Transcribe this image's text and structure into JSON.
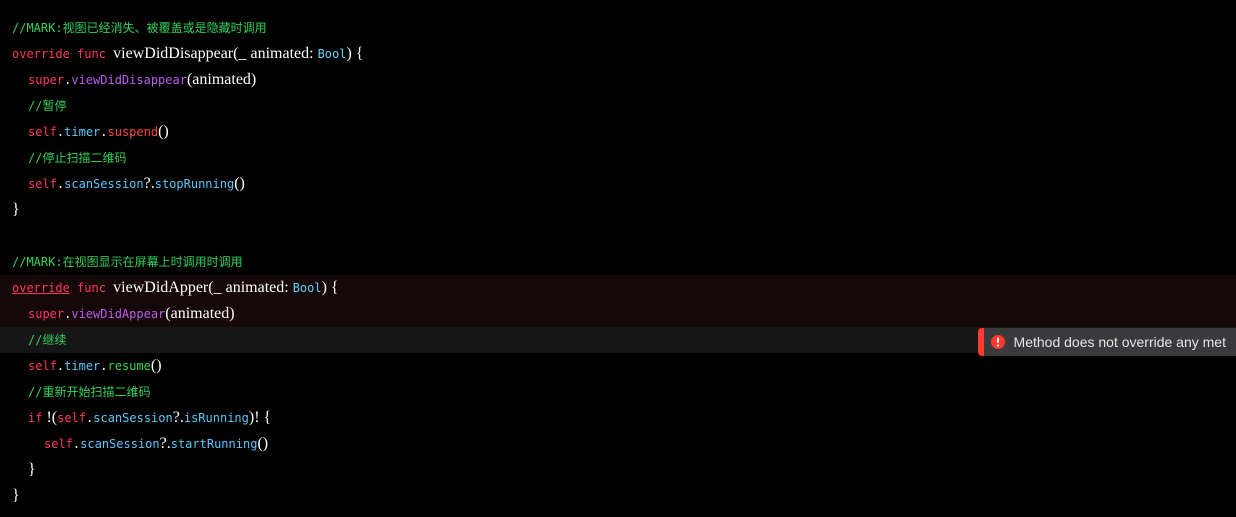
{
  "code": {
    "mark1": "//MARK:视图已经消失、被覆盖或是隐藏时调用",
    "override": "override",
    "func": "func",
    "fn1_name": "viewDidDisappear",
    "param_prefix": "(_ ",
    "animated": "animated",
    "colon_space": ": ",
    "bool": "Bool",
    "fn_tail": ") {",
    "super_call1_a": "super",
    "dot": ".",
    "super_call1_b": "viewDidDisappear",
    "args_open": "(",
    "args_animated": "animated",
    "args_close": ")",
    "comment_pause": "//暂停",
    "self": "self",
    "timer": "timer",
    "suspend": "suspend",
    "empty_parens": "()",
    "comment_stopscan": "//停止扫描二维码",
    "scanSession": "scanSession",
    "qmark_dot": "?.",
    "stopRunning": "stopRunning",
    "close_brace": "}",
    "mark2": "//MARK:在视图显示在屏幕上时调用时调用",
    "fn2_name": "viewDidApper",
    "super_call2_b": "viewDidAppear",
    "comment_continue": "//继续",
    "resume": "resume",
    "comment_restart": "//重新开始扫描二维码",
    "if": "if",
    "bang": " !",
    "isRunning": "isRunning",
    "bang_close": ")! {",
    "startRunning": "startRunning"
  },
  "error": {
    "message": "Method does not override any met"
  }
}
